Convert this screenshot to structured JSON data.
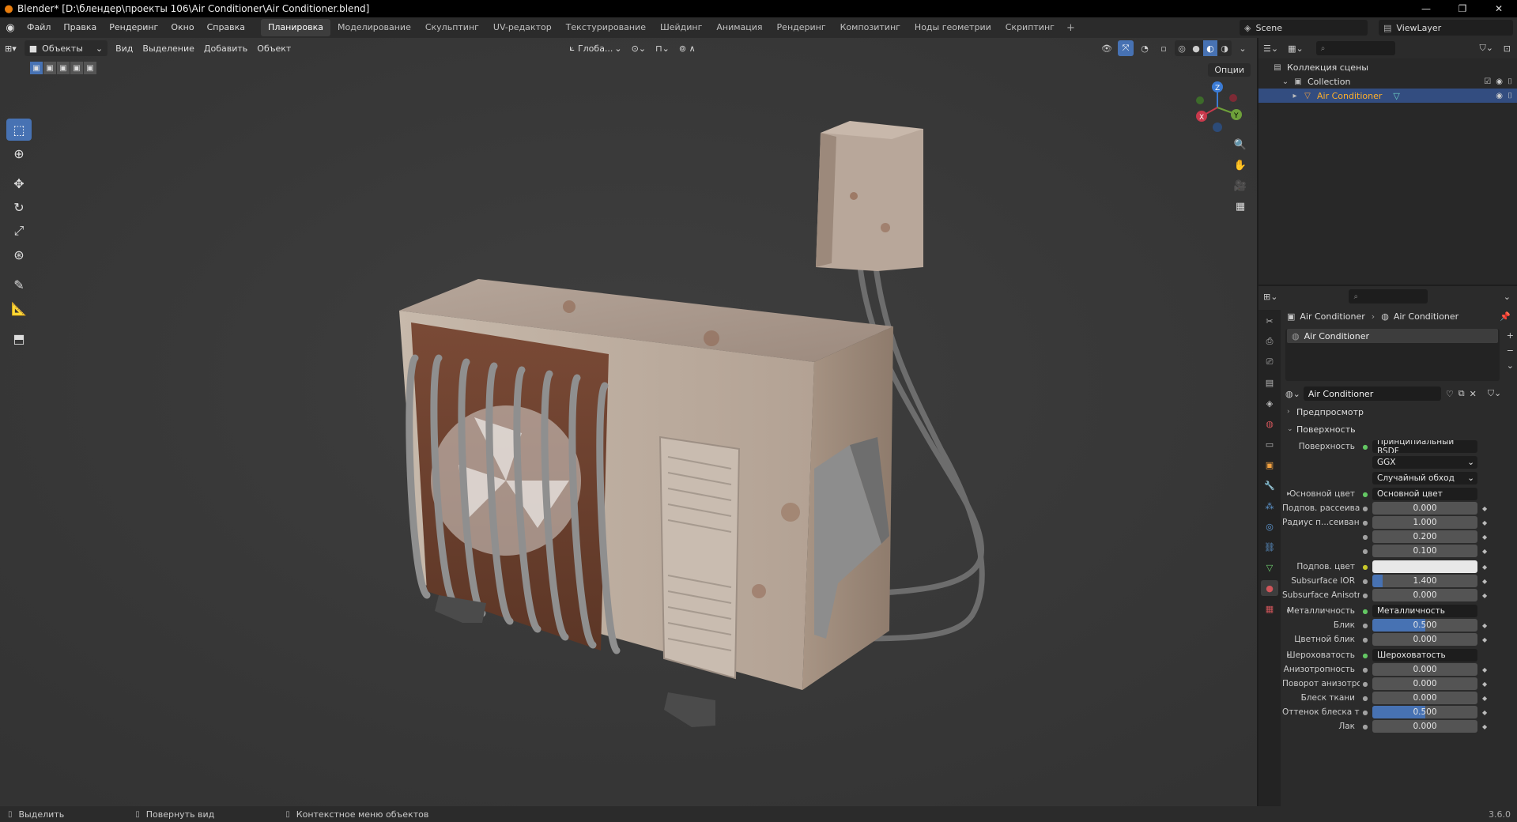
{
  "window": {
    "title": "Blender* [D:\\блендер\\проекты 106\\Air Conditioner\\Air Conditioner.blend]",
    "minimize": "—",
    "maximize": "❐",
    "close": "✕"
  },
  "menu": [
    "Файл",
    "Правка",
    "Рендеринг",
    "Окно",
    "Справка"
  ],
  "workspaces": [
    {
      "label": "Планировка",
      "active": true
    },
    {
      "label": "Моделирование"
    },
    {
      "label": "Скульптинг"
    },
    {
      "label": "UV-редактор"
    },
    {
      "label": "Текстурирование"
    },
    {
      "label": "Шейдинг"
    },
    {
      "label": "Анимация"
    },
    {
      "label": "Рендеринг"
    },
    {
      "label": "Композитинг"
    },
    {
      "label": "Ноды геометрии"
    },
    {
      "label": "Скриптинг"
    }
  ],
  "scene": "Scene",
  "view_layer": "ViewLayer",
  "viewport": {
    "mode": "Объекты",
    "menus": [
      "Вид",
      "Выделение",
      "Добавить",
      "Объект"
    ],
    "transform_orientation": "Глоба...",
    "options": "Опции"
  },
  "outliner": {
    "rows": [
      {
        "label": "Коллекция сцены",
        "indent": 0
      },
      {
        "label": "Collection",
        "indent": 1
      },
      {
        "label": "Air Conditioner",
        "indent": 2,
        "selected": true
      }
    ]
  },
  "properties": {
    "breadcrumb": [
      "Air Conditioner",
      "Air Conditioner"
    ],
    "slot": "Air Conditioner",
    "material_name": "Air Conditioner",
    "sections": {
      "preview": "Предпросмотр",
      "surface": "Поверхность"
    },
    "rows": [
      {
        "label": "Поверхность",
        "value": "Принципиальный BSDF",
        "kind": "link"
      },
      {
        "label": "",
        "value": "GGX",
        "kind": "dropdown"
      },
      {
        "label": "",
        "value": "Случайный обход",
        "kind": "dropdown"
      },
      {
        "label": "Основной цвет",
        "value": "Основной цвет",
        "kind": "link",
        "expand": true
      },
      {
        "label": "Подпов. рассеива...",
        "value": "0.000",
        "kind": "num"
      },
      {
        "label": "Радиус п...сеивания",
        "value": "1.000",
        "kind": "num"
      },
      {
        "label": "",
        "value": "0.200",
        "kind": "num"
      },
      {
        "label": "",
        "value": "0.100",
        "kind": "num"
      },
      {
        "label": "Подпов. цвет",
        "value": "",
        "kind": "color"
      },
      {
        "label": "Subsurface IOR",
        "value": "1.400",
        "kind": "num",
        "fill": 0.1
      },
      {
        "label": "Subsurface Anisotr...",
        "value": "0.000",
        "kind": "num"
      },
      {
        "label": "Металличность",
        "value": "Металличность",
        "kind": "link",
        "expand": true
      },
      {
        "label": "Блик",
        "value": "0.500",
        "kind": "num",
        "fill": 0.5
      },
      {
        "label": "Цветной блик",
        "value": "0.000",
        "kind": "num"
      },
      {
        "label": "Шероховатость",
        "value": "Шероховатость",
        "kind": "link",
        "expand": true
      },
      {
        "label": "Анизотропность",
        "value": "0.000",
        "kind": "num"
      },
      {
        "label": "Поворот анизотро...",
        "value": "0.000",
        "kind": "num"
      },
      {
        "label": "Блеск ткани",
        "value": "0.000",
        "kind": "num"
      },
      {
        "label": "Оттенок блеска тк...",
        "value": "0.500",
        "kind": "num",
        "fill": 0.5
      },
      {
        "label": "Лак",
        "value": "0.000",
        "kind": "num"
      }
    ]
  },
  "status": {
    "select": "Выделить",
    "rotate": "Повернуть вид",
    "context": "Контекстное меню объектов",
    "version": "3.6.0"
  },
  "colors": {
    "accent": "#4772b3",
    "selected_text": "#ffaf29",
    "viewport_bg": "#393939"
  }
}
